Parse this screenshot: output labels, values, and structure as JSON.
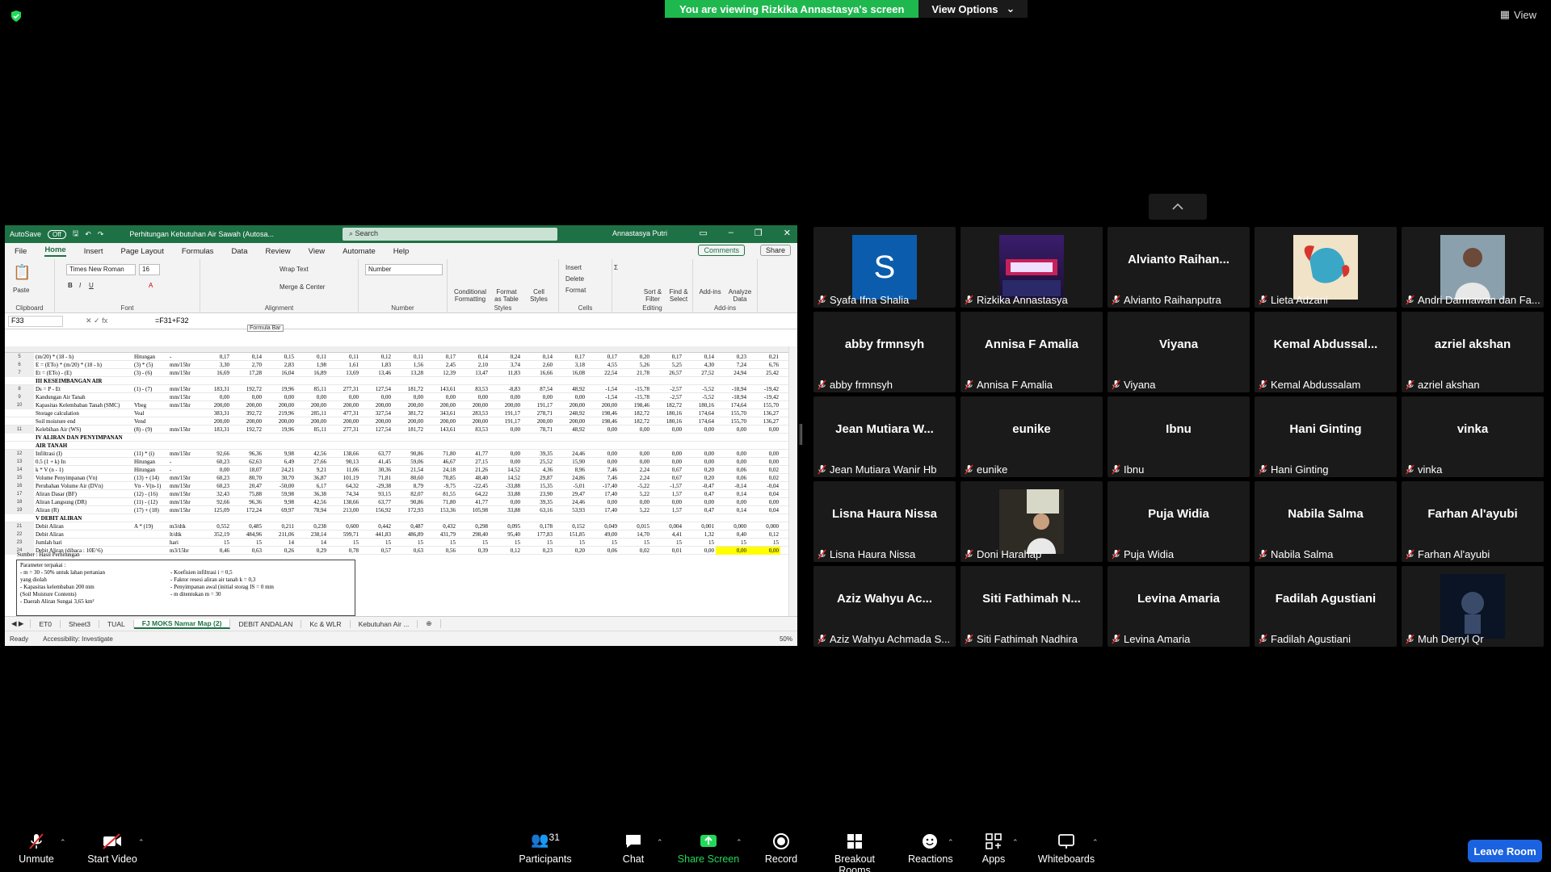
{
  "top": {
    "viewing_banner": "You are viewing Rizkika Annastasya's screen",
    "view_options": "View Options",
    "view": "View"
  },
  "excel": {
    "autosave_label": "AutoSave",
    "autosave_state": "Off",
    "file_name": "Perhitungan Kebutuhan Air Sawah (Autosa...",
    "search_placeholder": "Search",
    "user_name": "Annastasya Putri",
    "tabs": [
      "File",
      "Home",
      "Insert",
      "Page Layout",
      "Formulas",
      "Data",
      "Review",
      "View",
      "Automate",
      "Help"
    ],
    "comments": "Comments",
    "share": "Share",
    "ribbon": {
      "paste": "Paste",
      "clipboard": "Clipboard",
      "font_name": "Times New Roman",
      "font_size": "16",
      "font": "Font",
      "wrap_text": "Wrap Text",
      "merge_center": "Merge & Center",
      "alignment": "Alignment",
      "number_format": "Number",
      "number": "Number",
      "conditional": "Conditional Formatting",
      "format_table": "Format as Table",
      "cell_styles": "Cell Styles",
      "styles": "Styles",
      "insert": "Insert",
      "delete": "Delete",
      "format": "Format",
      "cells": "Cells",
      "sort_filter": "Sort & Filter",
      "find_select": "Find & Select",
      "editing": "Editing",
      "addins": "Add-ins",
      "analyze": "Analyze Data",
      "addins_grp": "Add-ins"
    },
    "name_box": "F33",
    "formula": "=F31+F32",
    "formula_tip": "Formula Bar",
    "rows": [
      {
        "n": "5",
        "a": "(m/20) * (18 - h)",
        "b": "Hitungan",
        "c": "-",
        "v": [
          "0,17",
          "0,14",
          "0,15",
          "0,11",
          "0,11",
          "0,12",
          "0,11",
          "0,17",
          "0,14",
          "0,24",
          "0,14",
          "0,17",
          "0,17",
          "0,20",
          "0,17",
          "0,14",
          "0,23",
          "0,21"
        ]
      },
      {
        "n": "6",
        "a": "E = (ETo) * (m/20) * (18 - h)",
        "b": "(3) * (5)",
        "c": "mm/15hr",
        "v": [
          "3,30",
          "2,70",
          "2,83",
          "1,98",
          "1,61",
          "1,83",
          "1,56",
          "2,45",
          "2,10",
          "3,74",
          "2,60",
          "3,18",
          "4,55",
          "5,26",
          "5,25",
          "4,30",
          "7,24",
          "6,76"
        ]
      },
      {
        "n": "7",
        "a": "Et = (ETo) - (E)",
        "b": "(3) - (6)",
        "c": "mm/15hr",
        "v": [
          "16,69",
          "17,28",
          "16,04",
          "16,89",
          "13,69",
          "13,46",
          "13,28",
          "12,39",
          "13,47",
          "11,83",
          "16,66",
          "16,08",
          "22,54",
          "21,78",
          "26,57",
          "27,52",
          "24,94",
          "25,42"
        ]
      },
      {
        "n": "",
        "a": "III   KESEIMBANGAN AIR",
        "b": "",
        "c": "",
        "v": [],
        "bold": true
      },
      {
        "n": "8",
        "a": "Ds = P - Et",
        "b": "(1) - (7)",
        "c": "mm/15hr",
        "v": [
          "183,31",
          "192,72",
          "19,96",
          "85,11",
          "277,31",
          "127,54",
          "181,72",
          "143,61",
          "83,53",
          "-8,83",
          "87,54",
          "48,92",
          "-1,54",
          "-15,78",
          "-2,57",
          "-5,52",
          "-18,94",
          "-19,42"
        ]
      },
      {
        "n": "9",
        "a": "Kandungan Air Tanah",
        "b": "",
        "c": "mm/15hr",
        "v": [
          "0,00",
          "0,00",
          "0,00",
          "0,00",
          "0,00",
          "0,00",
          "0,00",
          "0,00",
          "0,00",
          "0,00",
          "0,00",
          "0,00",
          "-1,54",
          "-15,78",
          "-2,57",
          "-5,52",
          "-18,94",
          "-19,42"
        ]
      },
      {
        "n": "10",
        "a": "Kapasitas Kelembaban Tanah (SMC)",
        "b": "Vbeg",
        "c": "mm/15hr",
        "v": [
          "200,00",
          "200,00",
          "200,00",
          "200,00",
          "200,00",
          "200,00",
          "200,00",
          "200,00",
          "200,00",
          "200,00",
          "191,17",
          "200,00",
          "200,00",
          "198,46",
          "182,72",
          "180,16",
          "174,64",
          "155,70"
        ]
      },
      {
        "n": "",
        "a": "Storage calculation",
        "b": "Veal",
        "c": "",
        "v": [
          "383,31",
          "392,72",
          "219,96",
          "285,11",
          "477,31",
          "327,54",
          "381,72",
          "343,61",
          "283,53",
          "191,17",
          "278,71",
          "248,92",
          "198,46",
          "182,72",
          "180,16",
          "174,64",
          "155,70",
          "136,27"
        ]
      },
      {
        "n": "",
        "a": "Soil moisture end",
        "b": "Vend",
        "c": "",
        "v": [
          "200,00",
          "200,00",
          "200,00",
          "200,00",
          "200,00",
          "200,00",
          "200,00",
          "200,00",
          "200,00",
          "191,17",
          "200,00",
          "200,00",
          "198,46",
          "182,72",
          "180,16",
          "174,64",
          "155,70",
          "136,27"
        ]
      },
      {
        "n": "11",
        "a": "Kelebihan Air (WS)",
        "b": "(8) - (9)",
        "c": "mm/15hr",
        "v": [
          "183,31",
          "192,72",
          "19,96",
          "85,11",
          "277,31",
          "127,54",
          "181,72",
          "143,61",
          "83,53",
          "0,00",
          "78,71",
          "48,92",
          "0,00",
          "0,00",
          "0,00",
          "0,00",
          "0,00",
          "0,00"
        ]
      },
      {
        "n": "",
        "a": "IV   ALIRAN DAN PENYIMPANAN",
        "b": "",
        "c": "",
        "v": [],
        "bold": true
      },
      {
        "n": "",
        "a": "        AIR TANAH",
        "b": "",
        "c": "",
        "v": [],
        "bold": true
      },
      {
        "n": "12",
        "a": "Infiltrasi (I)",
        "b": "(11) * (i)",
        "c": "mm/15hr",
        "v": [
          "92,66",
          "96,36",
          "9,98",
          "42,56",
          "138,66",
          "63,77",
          "90,86",
          "71,80",
          "41,77",
          "0,00",
          "39,35",
          "24,46",
          "0,00",
          "0,00",
          "0,00",
          "0,00",
          "0,00",
          "0,00"
        ]
      },
      {
        "n": "13",
        "a": "0.5 (1 + k) In",
        "b": "Hitungan",
        "c": "-",
        "v": [
          "60,23",
          "62,63",
          "6,49",
          "27,66",
          "90,13",
          "41,45",
          "59,06",
          "46,67",
          "27,15",
          "0,00",
          "25,52",
          "15,90",
          "0,00",
          "0,00",
          "0,00",
          "0,00",
          "0,00",
          "0,00"
        ]
      },
      {
        "n": "14",
        "a": "k * V (n - 1)",
        "b": "Hitungan",
        "c": "-",
        "v": [
          "0,00",
          "18,07",
          "24,21",
          "9,21",
          "11,06",
          "30,36",
          "21,54",
          "24,18",
          "21,26",
          "14,52",
          "4,36",
          "8,96",
          "7,46",
          "2,24",
          "0,67",
          "0,20",
          "0,06",
          "0,02"
        ]
      },
      {
        "n": "15",
        "a": "Volume Penyimpanan (Vn)",
        "b": "(13) + (14)",
        "c": "mm/15hr",
        "v": [
          "60,23",
          "80,70",
          "30,70",
          "36,87",
          "101,19",
          "71,81",
          "80,60",
          "70,85",
          "48,40",
          "14,52",
          "29,87",
          "24,86",
          "7,46",
          "2,24",
          "0,67",
          "0,20",
          "0,06",
          "0,02"
        ]
      },
      {
        "n": "16",
        "a": "Perubahan Volume Air (DVn)",
        "b": "Vn - V(n-1)",
        "c": "mm/15hr",
        "v": [
          "60,23",
          "20,47",
          "-50,00",
          "6,17",
          "64,32",
          "-29,38",
          "8,79",
          "-9,75",
          "-22,45",
          "-33,88",
          "15,35",
          "-5,01",
          "-17,40",
          "-5,22",
          "-1,57",
          "-0,47",
          "-0,14",
          "-0,04"
        ]
      },
      {
        "n": "17",
        "a": "Aliran Dasar (BF)",
        "b": "(12) - (16)",
        "c": "mm/15hr",
        "v": [
          "32,43",
          "75,88",
          "59,98",
          "36,38",
          "74,34",
          "93,15",
          "82,07",
          "81,55",
          "64,22",
          "33,88",
          "23,90",
          "29,47",
          "17,40",
          "5,22",
          "1,57",
          "0,47",
          "0,14",
          "0,04"
        ]
      },
      {
        "n": "18",
        "a": "Aliran Langsung (DR)",
        "b": "(11) - (12)",
        "c": "mm/15hr",
        "v": [
          "92,66",
          "96,36",
          "9,98",
          "42,56",
          "138,66",
          "63,77",
          "90,86",
          "71,80",
          "41,77",
          "0,00",
          "39,35",
          "24,46",
          "0,00",
          "0,00",
          "0,00",
          "0,00",
          "0,00",
          "0,00"
        ]
      },
      {
        "n": "19",
        "a": "Aliran (R)",
        "b": "(17) + (18)",
        "c": "mm/15hr",
        "v": [
          "125,09",
          "172,24",
          "69,97",
          "78,94",
          "213,00",
          "156,92",
          "172,93",
          "153,36",
          "105,98",
          "33,88",
          "63,16",
          "53,93",
          "17,40",
          "5,22",
          "1,57",
          "0,47",
          "0,14",
          "0,04"
        ]
      },
      {
        "n": "",
        "a": "V   DEBIT ALIRAN",
        "b": "",
        "c": "",
        "v": [],
        "bold": true
      },
      {
        "n": "21",
        "a": "Debit Aliran",
        "b": "A * (19)",
        "c": "m3/dtk",
        "v": [
          "0,552",
          "0,485",
          "0,211",
          "0,238",
          "0,600",
          "0,442",
          "0,487",
          "0,432",
          "0,298",
          "0,095",
          "0,178",
          "0,152",
          "0,049",
          "0,015",
          "0,004",
          "0,001",
          "0,000",
          "0,000"
        ]
      },
      {
        "n": "22",
        "a": "Debit Aliran",
        "b": "",
        "c": "lt/dtk",
        "v": [
          "352,19",
          "484,96",
          "211,06",
          "238,14",
          "599,71",
          "441,83",
          "486,89",
          "431,79",
          "298,40",
          "95,40",
          "177,83",
          "151,85",
          "49,00",
          "14,70",
          "4,41",
          "1,32",
          "0,40",
          "0,12"
        ]
      },
      {
        "n": "23",
        "a": "Jumlah hari",
        "b": "",
        "c": "hari",
        "v": [
          "15",
          "15",
          "14",
          "14",
          "15",
          "15",
          "15",
          "15",
          "15",
          "15",
          "15",
          "15",
          "15",
          "15",
          "15",
          "15",
          "15",
          "15"
        ]
      },
      {
        "n": "24",
        "a": "Debit Aliran  (dibaca : 10E^6)",
        "b": "",
        "c": "m3/15hr",
        "v": [
          "0,46",
          "0,63",
          "0,26",
          "0,29",
          "0,78",
          "0,57",
          "0,63",
          "0,56",
          "0,39",
          "0,12",
          "0,23",
          "0,20",
          "0,06",
          "0,02",
          "0,01",
          "0,00",
          "0,00",
          "0,00"
        ]
      }
    ],
    "source_note": "Sumber : Hasil Perhitungan",
    "notes": {
      "title": "Parameter terpakai :",
      "l1": "- m = 30 - 50% untuk lahan pertanian",
      "l2": "        yang diolah",
      "l3": "- Kapasitas kelembaban        200  mm",
      "l4": "  (Soil Moisture Contents)",
      "l5": "- Daerah Aliran Sungai          3,65  km²",
      "r1": "- Koefisien infiltrasi        i    =        0,5",
      "r2": "- Faktor resesi aliran air tanah   k   =        0,3",
      "r3": "- Penyimpanan awal (initial storag  IS  =        0   mm",
      "r4": "- m ditentukan                m  =        30"
    },
    "sheets": [
      "ET0",
      "Sheet3",
      "TUAL",
      "FJ MOKS Namar Map (2)",
      "DEBIT ANDALAN",
      "Kc & WLR",
      "Kebutuhan Air ..."
    ],
    "status_ready": "Ready",
    "status_access": "Accessibility: Investigate",
    "zoom": "50%"
  },
  "participants": [
    {
      "big": "S",
      "name": "Syafa Ifna Shalia",
      "type": "letter"
    },
    {
      "big": "",
      "name": "Rizkika Annastasya",
      "type": "photo-punk"
    },
    {
      "big": "Alvianto  Raihan...",
      "name": "Alvianto Raihanputra",
      "type": "text"
    },
    {
      "big": "",
      "name": "Lieta Adzani",
      "type": "photo-fish"
    },
    {
      "big": "",
      "name": "Andri Darmawan dan Fa...",
      "type": "photo-person"
    },
    {
      "big": "abby frmnsyh",
      "name": "abby frmnsyh",
      "type": "text"
    },
    {
      "big": "Annisa F Amalia",
      "name": "Annisa F Amalia",
      "type": "text"
    },
    {
      "big": "Viyana",
      "name": "Viyana",
      "type": "text"
    },
    {
      "big": "Kemal  Abdussal...",
      "name": "Kemal Abdussalam",
      "type": "text"
    },
    {
      "big": "azriel akshan",
      "name": "azriel akshan",
      "type": "text"
    },
    {
      "big": "Jean Mutiara W...",
      "name": "Jean Mutiara Wanir Hb",
      "type": "text"
    },
    {
      "big": "eunike",
      "name": "eunike",
      "type": "text"
    },
    {
      "big": "Ibnu",
      "name": "Ibnu",
      "type": "text"
    },
    {
      "big": "Hani Ginting",
      "name": "Hani Ginting",
      "type": "text"
    },
    {
      "big": "vinka",
      "name": "vinka",
      "type": "text"
    },
    {
      "big": "Lisna Haura Nissa",
      "name": "Lisna Haura Nissa",
      "type": "text"
    },
    {
      "big": "",
      "name": "Doni Harahap",
      "type": "photo-doni"
    },
    {
      "big": "Puja Widia",
      "name": "Puja Widia",
      "type": "text"
    },
    {
      "big": "Nabila Salma",
      "name": "Nabila Salma",
      "type": "text"
    },
    {
      "big": "Farhan Al'ayubi",
      "name": "Farhan Al'ayubi",
      "type": "text"
    },
    {
      "big": "Aziz Wahyu  Ac...",
      "name": "Aziz Wahyu  Achmada S...",
      "type": "text"
    },
    {
      "big": "Siti Fathimah N...",
      "name": "Siti Fathimah Nadhira",
      "type": "text"
    },
    {
      "big": "Levina Amaria",
      "name": "Levina Amaria",
      "type": "text"
    },
    {
      "big": "Fadilah Agustiani",
      "name": "Fadilah Agustiani",
      "type": "text"
    },
    {
      "big": "",
      "name": "Muh Derryl Qr",
      "type": "photo-dark"
    }
  ],
  "toolbar": {
    "unmute": "Unmute",
    "start_video": "Start Video",
    "participants": "Participants",
    "participants_count": "31",
    "chat": "Chat",
    "share_screen": "Share Screen",
    "record": "Record",
    "breakout": "Breakout Rooms",
    "reactions": "Reactions",
    "apps": "Apps",
    "whiteboards": "Whiteboards",
    "leave": "Leave Room"
  },
  "colors": {
    "green_banner": "#1fb84f",
    "excel_green": "#1e7145",
    "leave_blue": "#1b62e0",
    "tile_bg": "#1a1a1a",
    "mute_red": "#e02828"
  }
}
